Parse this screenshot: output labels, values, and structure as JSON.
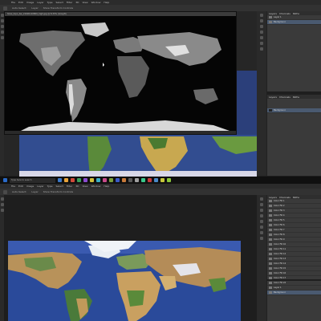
{
  "top_app": {
    "menu": [
      "File",
      "Edit",
      "Image",
      "Layer",
      "Type",
      "Select",
      "Filter",
      "3D",
      "View",
      "Window",
      "Help"
    ],
    "options": [
      "Auto-Select:",
      "Layer",
      "Show Transform Controls"
    ],
    "doc_title": "hires_topo_bw_21600x10800_high.jpg @ 8.33% (Gray/8)",
    "status": "8.33%",
    "panel_tabs": [
      "Layers",
      "Channels",
      "Paths"
    ],
    "layers": [
      {
        "name": "Layer 1"
      },
      {
        "name": "Background"
      }
    ],
    "lower_panel_tabs": [
      "Layers",
      "Channels",
      "Paths"
    ],
    "lower_layer": {
      "name": "Background"
    }
  },
  "taskbar": {
    "search_placeholder": "Type here to search",
    "icon_colors": [
      "#3a78c8",
      "#e8a33a",
      "#d04a3a",
      "#3aa05a",
      "#8a4ad0",
      "#d0c03a",
      "#3ab0c8",
      "#c84a8a",
      "#7aa03a",
      "#3a5ac8",
      "#c87a3a",
      "#5a5a5a",
      "#a0a0a0",
      "#3ac88a",
      "#c83a3a",
      "#4a8ac8",
      "#c8c83a",
      "#8ac83a"
    ]
  },
  "bottom_app": {
    "menu": [
      "File",
      "Edit",
      "Image",
      "Layer",
      "Type",
      "Select",
      "Filter",
      "3D",
      "View",
      "Window",
      "Help"
    ],
    "options": [
      "Auto-Select:",
      "Layer",
      "Show Transform Controls"
    ],
    "doc_title": "world.topo.bathy.200412.3x21600x10800.jpg @ 8.33% (RGB/8)",
    "panel_tabs": [
      "Layers",
      "Channels",
      "Paths"
    ],
    "layers": [
      {
        "name": "Color Fill 1"
      },
      {
        "name": "Color Fill 2"
      },
      {
        "name": "Color Fill 3"
      },
      {
        "name": "Color Fill 4"
      },
      {
        "name": "Color Fill 5"
      },
      {
        "name": "Color Fill 6"
      },
      {
        "name": "Color Fill 7"
      },
      {
        "name": "Color Fill 8"
      },
      {
        "name": "Color Fill 9"
      },
      {
        "name": "Color Fill 10"
      },
      {
        "name": "Color Fill 11"
      },
      {
        "name": "Color Fill 12"
      },
      {
        "name": "Color Fill 13"
      },
      {
        "name": "Color Fill 14"
      },
      {
        "name": "Color Fill 15"
      },
      {
        "name": "Color Fill 16"
      },
      {
        "name": "Color Fill 17"
      },
      {
        "name": "Color Fill 18"
      },
      {
        "name": "Color Fill 19"
      },
      {
        "name": "Color Fill 20"
      },
      {
        "name": "Color Fill 21"
      }
    ],
    "lower_layers": [
      {
        "name": "Color Fill 22"
      },
      {
        "name": "Layer 1"
      },
      {
        "name": "Background"
      }
    ]
  }
}
